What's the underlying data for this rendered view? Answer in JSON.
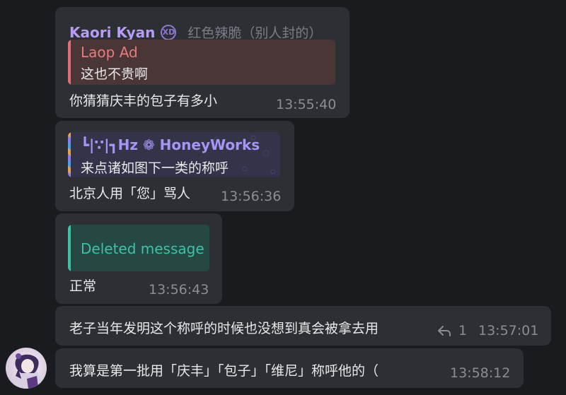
{
  "messages": [
    {
      "sender": "Kaori Kyan",
      "sender_badge": "XD",
      "sender_title": "红色辣脆（别人封的）",
      "reply": {
        "author": "Laop Ad",
        "text": "这也不贵啊",
        "accent": "#e06c75"
      },
      "text": "你猜猜庆丰的包子有多小",
      "time": "13:55:40"
    },
    {
      "reply": {
        "author": "┗|∵|┓Hz ❁ HoneyWorks",
        "text": "来点诸如图下一类的称呼",
        "accent": "#8b7cf0"
      },
      "text": "北京人用「您」骂人",
      "time": "13:56:36"
    },
    {
      "reply": {
        "author": "Deleted message",
        "accent": "#3ec1a4"
      },
      "text": "正常",
      "time": "13:56:43"
    },
    {
      "text": "老子当年发明这个称呼的时候也没想到真会被拿去用",
      "reply_count": "1",
      "time": "13:57:01"
    },
    {
      "text": "我算是第一批用「庆丰」「包子」「维尼」称呼他的（",
      "time": "13:58:12"
    }
  ],
  "icons": {
    "reply_icon": "reply-arrow-icon",
    "sender_badge_icon": "xd-badge-icon",
    "avatar": "user-avatar"
  },
  "colors": {
    "background": "#1a1b1f",
    "bubble": "#2c2f34",
    "sender_name": "#b79cf2",
    "timestamp": "#8b8d93"
  }
}
